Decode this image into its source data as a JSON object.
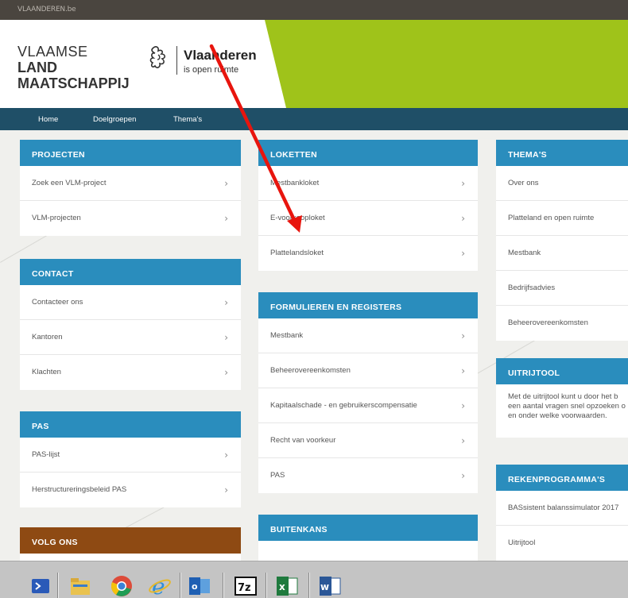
{
  "site_label": "VLAANDEREN.be",
  "brand": {
    "line1": "VLAAMSE",
    "line2": "LAND",
    "line3": "MAATSCHAPPIJ",
    "gov_name": "Vlaanderen",
    "gov_tagline": "is open ruimte"
  },
  "nav": [
    "Home",
    "Doelgroepen",
    "Thema's"
  ],
  "panels": {
    "projecten": {
      "title": "PROJECTEN",
      "items": [
        "Zoek een VLM-project",
        "VLM-projecten"
      ]
    },
    "contact": {
      "title": "CONTACT",
      "items": [
        "Contacteer ons",
        "Kantoren",
        "Klachten"
      ]
    },
    "pas": {
      "title": "PAS",
      "items": [
        "PAS-lijst",
        "Herstructureringsbeleid PAS"
      ]
    },
    "volg": {
      "title": "VOLG ONS"
    },
    "loketten": {
      "title": "LOKETTEN",
      "items": [
        "Mestbankloket",
        "E-voorkooploket",
        "Plattelandsloket"
      ]
    },
    "formulieren": {
      "title": "FORMULIEREN EN REGISTERS",
      "items": [
        "Mestbank",
        "Beheerovereenkomsten",
        "Kapitaalschade - en gebruikerscompensatie",
        "Recht van voorkeur",
        "PAS"
      ]
    },
    "buitenkans": {
      "title": "BUITENKANS"
    },
    "themas": {
      "title": "THEMA'S",
      "items": [
        "Over ons",
        "Platteland en open ruimte",
        "Mestbank",
        "Bedrijfsadvies",
        "Beheerovereenkomsten"
      ]
    },
    "uitrijtool": {
      "title": "UITRIJTOOL",
      "text": [
        "Met de uitrijtool kunt u door het b",
        "een aantal vragen snel opzoeken o",
        "en onder welke voorwaarden."
      ]
    },
    "rekenprogrammas": {
      "title": "REKENPROGRAMMA'S",
      "items": [
        "BASsistent balanssimulator 2017",
        "Uitrijtool"
      ]
    }
  },
  "chevron": "›",
  "taskbar": {
    "icons": [
      "powershell-icon",
      "file-explorer-icon",
      "chrome-icon",
      "internet-explorer-icon",
      "outlook-icon",
      "7zip-icon",
      "excel-icon",
      "word-icon"
    ]
  },
  "colors": {
    "panel_header": "#2a8dbd",
    "volg_header": "#8e4a13",
    "nav_bar": "#1f4f67",
    "brand_green": "#9fc31a",
    "annotation_arrow": "#e8150e"
  }
}
